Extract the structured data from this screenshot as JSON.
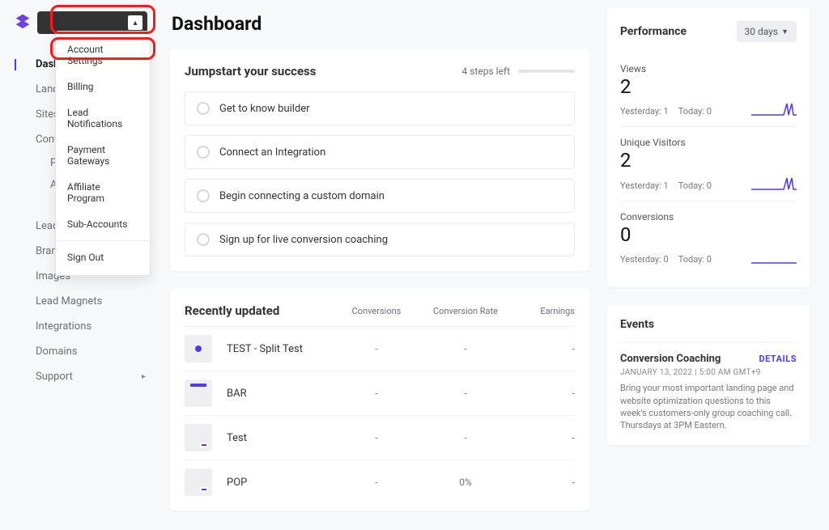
{
  "page_title": "Dashboard",
  "dropdown": {
    "items": [
      "Account Settings",
      "Billing",
      "Lead Notifications",
      "Payment Gateways",
      "Affiliate Program",
      "Sub-Accounts"
    ],
    "sign_out": "Sign Out"
  },
  "nav": {
    "dashboard": "Dashboard",
    "landing": "Landing",
    "sites": "Sites",
    "conversion": "Conve",
    "conv_sub1": "P",
    "conv_sub2": "A",
    "leads": "Leads",
    "brand": "Brand",
    "images": "Images",
    "lead_magnets": "Lead Magnets",
    "integrations": "Integrations",
    "domains": "Domains",
    "support": "Support"
  },
  "jumpstart": {
    "title": "Jumpstart your success",
    "steps_left": "4 steps left",
    "items": [
      "Get to know builder",
      "Connect an Integration",
      "Begin connecting a custom domain",
      "Sign up for live conversion coaching"
    ]
  },
  "recent": {
    "title": "Recently updated",
    "cols": {
      "conversions": "Conversions",
      "rate": "Conversion Rate",
      "earnings": "Earnings"
    },
    "rows": [
      {
        "name": "TEST - Split Test",
        "conversions": "-",
        "rate": "-",
        "earnings": "-",
        "thumb": "dot"
      },
      {
        "name": "BAR",
        "conversions": "-",
        "rate": "-",
        "earnings": "-",
        "thumb": "bar-top"
      },
      {
        "name": "Test",
        "conversions": "-",
        "rate": "-",
        "earnings": "-",
        "thumb": "corner"
      },
      {
        "name": "POP",
        "conversions": "-",
        "rate": "0%",
        "earnings": "-",
        "thumb": "corner"
      }
    ]
  },
  "performance": {
    "title": "Performance",
    "range": "30 days",
    "metrics": [
      {
        "label": "Views",
        "value": "2",
        "yesterday": "Yesterday: 1",
        "today": "Today: 0",
        "spike": true
      },
      {
        "label": "Unique Visitors",
        "value": "2",
        "yesterday": "Yesterday: 1",
        "today": "Today: 0",
        "spike": true
      },
      {
        "label": "Conversions",
        "value": "0",
        "yesterday": "Yesterday: 0",
        "today": "Today: 0",
        "spike": false
      }
    ]
  },
  "events": {
    "title": "Events",
    "event_name": "Conversion Coaching",
    "details": "DETAILS",
    "time": "JANUARY 13, 2022 | 5:00 AM GMT+9",
    "desc": "Bring your most important landing page and website optimization questions to this week's customers-only group coaching call. Thursdays at 3PM Eastern."
  }
}
